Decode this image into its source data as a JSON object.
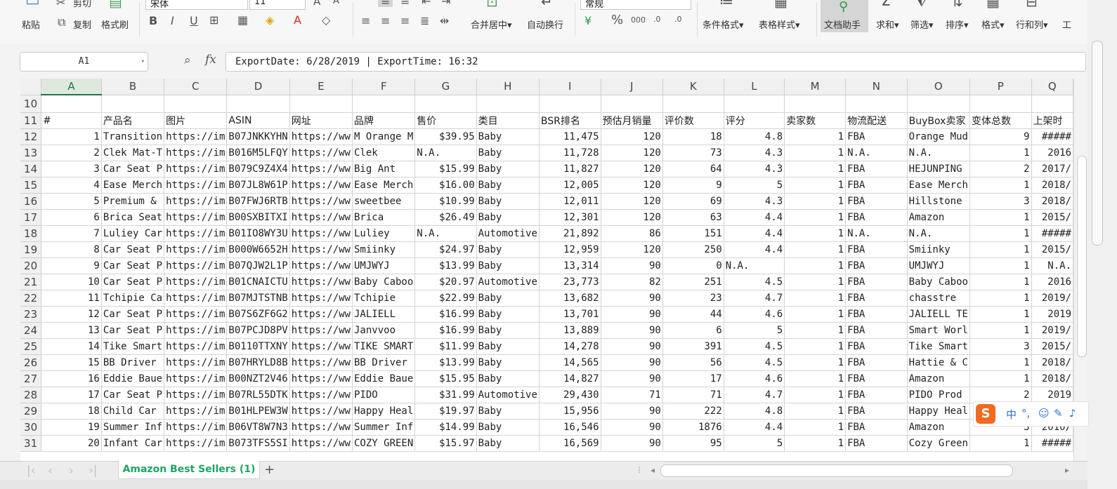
{
  "ribbon": {
    "clipboard": {
      "cut": "剪切",
      "paste": "粘贴",
      "copy": "复制",
      "format_painter": "格式刷"
    },
    "font": {
      "name": "宋体",
      "size": "11"
    },
    "merge_center": "合并居中",
    "wrap_text": "自动换行",
    "number_format": "常规",
    "percent": "%",
    "thousands": "000",
    "conditional_format": "条件格式",
    "table_style": "表格样式",
    "doc_helper": "文档助手",
    "sum": "求和",
    "filter": "筛选",
    "sort": "排序",
    "format": "格式",
    "row_col": "行和列",
    "worksheet": "工"
  },
  "formula_bar": {
    "name_box": "A1",
    "content": "ExportDate: 6/28/2019 | ExportTime: 16:32"
  },
  "columns": [
    "A",
    "B",
    "C",
    "D",
    "E",
    "F",
    "G",
    "H",
    "I",
    "J",
    "K",
    "L",
    "M",
    "N",
    "O",
    "P",
    "Q"
  ],
  "active_column": "A",
  "header_row": {
    "row_num": "11",
    "cells": [
      "#",
      "产品名",
      "图片",
      "ASIN",
      "网址",
      "品牌",
      "售价",
      "类目",
      "BSR排名",
      "预估月销量",
      "评价数",
      "评分",
      "卖家数",
      "物流配送",
      "BuyBox卖家",
      "变体总数",
      "上架时"
    ]
  },
  "rows": [
    {
      "n": "12",
      "c": [
        "1",
        "Transition",
        "https://im",
        "B07JNKKYHN",
        "https://ww",
        "M Orange M",
        "$39.95",
        "Baby",
        "11,475",
        "120",
        "18",
        "4.8",
        "1",
        "FBA",
        "Orange Mud",
        "9",
        "#####"
      ]
    },
    {
      "n": "13",
      "c": [
        "2",
        "Clek Mat-T",
        "https://im",
        "B016M5LFQY",
        "https://ww",
        "Clek",
        "N.A.",
        "Baby",
        "11,728",
        "120",
        "73",
        "4.3",
        "1",
        "N.A.",
        "N.A.",
        "1",
        "2016"
      ]
    },
    {
      "n": "14",
      "c": [
        "3",
        "Car Seat P",
        "https://im",
        "B079C9Z4X4",
        "https://ww",
        "Big Ant",
        "$15.99",
        "Baby",
        "11,827",
        "120",
        "64",
        "4.3",
        "1",
        "FBA",
        "HEJUNPING",
        "2",
        "2017/"
      ]
    },
    {
      "n": "15",
      "c": [
        "4",
        "Ease Merch",
        "https://im",
        "B07JL8W61P",
        "https://ww",
        "Ease Merch",
        "$16.00",
        "Baby",
        "12,005",
        "120",
        "9",
        "5",
        "1",
        "FBA",
        "Ease Merch",
        "1",
        "2018/"
      ]
    },
    {
      "n": "16",
      "c": [
        "5",
        "Premium &",
        "https://im",
        "B07FWJ6RTB",
        "https://ww",
        "sweetbee",
        "$10.99",
        "Baby",
        "12,011",
        "120",
        "69",
        "4.3",
        "1",
        "FBA",
        "Hillstone",
        "3",
        "2018/"
      ]
    },
    {
      "n": "17",
      "c": [
        "6",
        "Brica Seat",
        "https://im",
        "B00SXBITXI",
        "https://ww",
        "Brica",
        "$26.49",
        "Baby",
        "12,301",
        "120",
        "63",
        "4.4",
        "1",
        "FBA",
        "Amazon",
        "1",
        "2015/"
      ]
    },
    {
      "n": "18",
      "c": [
        "7",
        "Luliey Car",
        "https://im",
        "B01IO8WY3U",
        "https://ww",
        "Luliey",
        "N.A.",
        "Automotive",
        "21,892",
        "86",
        "151",
        "4.4",
        "1",
        "N.A.",
        "N.A.",
        "1",
        "#####"
      ]
    },
    {
      "n": "19",
      "c": [
        "8",
        "Car Seat P",
        "https://im",
        "B000W6652H",
        "https://ww",
        "Smiinky",
        "$24.97",
        "Baby",
        "12,959",
        "120",
        "250",
        "4.4",
        "1",
        "FBA",
        "Smiinky",
        "1",
        "2015/"
      ]
    },
    {
      "n": "20",
      "c": [
        "9",
        "Car Seat P",
        "https://im",
        "B07QJW2L1P",
        "https://ww",
        "UMJWYJ",
        "$13.99",
        "Baby",
        "13,314",
        "90",
        "0",
        "N.A.",
        "1",
        "FBA",
        "UMJWYJ",
        "1",
        "N.A."
      ]
    },
    {
      "n": "21",
      "c": [
        "10",
        "Car Seat P",
        "https://im",
        "B01CNAICTU",
        "https://ww",
        "Baby Caboo",
        "$20.97",
        "Automotive",
        "23,773",
        "82",
        "251",
        "4.5",
        "1",
        "FBA",
        "Baby Caboo",
        "1",
        "2016"
      ]
    },
    {
      "n": "22",
      "c": [
        "11",
        "Tchipie Ca",
        "https://im",
        "B07MJTSTNB",
        "https://ww",
        "Tchipie",
        "$22.99",
        "Baby",
        "13,682",
        "90",
        "23",
        "4.7",
        "1",
        "FBA",
        "chasstre",
        "1",
        "2019/"
      ]
    },
    {
      "n": "23",
      "c": [
        "12",
        "Car Seat P",
        "https://im",
        "B07S6ZF6G2",
        "https://ww",
        "JALIELL",
        "$16.99",
        "Baby",
        "13,701",
        "90",
        "44",
        "4.6",
        "1",
        "FBA",
        "JALIELL TE",
        "1",
        "2019"
      ]
    },
    {
      "n": "24",
      "c": [
        "13",
        "Car Seat P",
        "https://im",
        "B07PCJD8PV",
        "https://ww",
        "Janvvoo",
        "$16.99",
        "Baby",
        "13,889",
        "90",
        "6",
        "5",
        "1",
        "FBA",
        "Smart Worl",
        "1",
        "2019/"
      ]
    },
    {
      "n": "25",
      "c": [
        "14",
        "Tike Smart",
        "https://im",
        "B0110TTXNY",
        "https://ww",
        "TIKE SMART",
        "$11.99",
        "Baby",
        "14,278",
        "90",
        "391",
        "4.5",
        "1",
        "FBA",
        "Tike Smart",
        "3",
        "2015/"
      ]
    },
    {
      "n": "26",
      "c": [
        "15",
        "BB Driver",
        "https://im",
        "B07HRYLD8B",
        "https://ww",
        "BB Driver",
        "$13.99",
        "Baby",
        "14,565",
        "90",
        "56",
        "4.5",
        "1",
        "FBA",
        "Hattie & C",
        "1",
        "2018/"
      ]
    },
    {
      "n": "27",
      "c": [
        "16",
        "Eddie Baue",
        "https://im",
        "B00NZT2V46",
        "https://ww",
        "Eddie Baue",
        "$15.95",
        "Baby",
        "14,827",
        "90",
        "17",
        "4.6",
        "1",
        "FBA",
        "Amazon",
        "1",
        "2018/"
      ]
    },
    {
      "n": "28",
      "c": [
        "17",
        "Car Seat P",
        "https://im",
        "B07RL55DTK",
        "https://ww",
        "PIDO",
        "$31.99",
        "Automotive",
        "29,430",
        "71",
        "71",
        "4.7",
        "1",
        "FBA",
        "PIDO Prod",
        "2",
        "2019"
      ]
    },
    {
      "n": "29",
      "c": [
        "18",
        "Child Car",
        "https://im",
        "B01HLPEW3W",
        "https://ww",
        "Happy Heal",
        "$19.97",
        "Baby",
        "15,956",
        "90",
        "222",
        "4.8",
        "1",
        "FBA",
        "Happy Heal",
        "2",
        "2016/"
      ]
    },
    {
      "n": "30",
      "c": [
        "19",
        "Summer Inf",
        "https://im",
        "B06VT8W7N3",
        "https://ww",
        "Summer Inf",
        "$14.99",
        "Baby",
        "16,546",
        "90",
        "1876",
        "4.4",
        "1",
        "FBA",
        "Amazon",
        "3",
        "2010/"
      ]
    },
    {
      "n": "31",
      "c": [
        "20",
        "Infant Car",
        "https://im",
        "B073TFS5SI",
        "https://ww",
        "COZY GREEN",
        "$15.97",
        "Baby",
        "16,569",
        "90",
        "95",
        "5",
        "1",
        "FBA",
        "Cozy Green",
        "1",
        "#####"
      ]
    }
  ],
  "sheet_tab": "Amazon Best Sellers (1)",
  "ime": {
    "logo": "S",
    "lang": "中"
  }
}
